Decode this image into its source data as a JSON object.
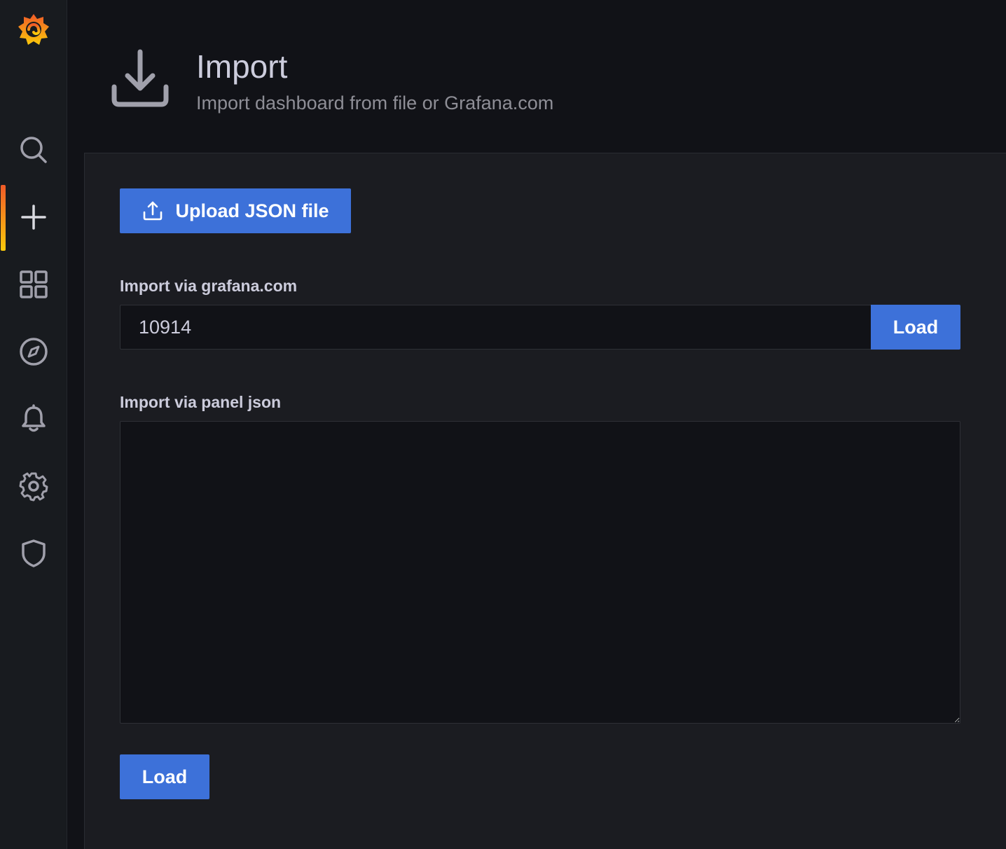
{
  "sidebar": {
    "logo": "grafana-logo-icon",
    "items": [
      {
        "icon": "search-icon"
      },
      {
        "icon": "plus-icon",
        "active": true
      },
      {
        "icon": "dashboards-grid-icon"
      },
      {
        "icon": "compass-icon"
      },
      {
        "icon": "bell-icon"
      },
      {
        "icon": "gear-icon"
      },
      {
        "icon": "shield-icon"
      }
    ]
  },
  "header": {
    "icon": "download-icon",
    "title": "Import",
    "subtitle": "Import dashboard from file or Grafana.com"
  },
  "upload": {
    "icon": "upload-icon",
    "label": "Upload JSON file"
  },
  "grafana_com": {
    "label": "Import via grafana.com",
    "value": "10914",
    "load_label": "Load"
  },
  "panel_json": {
    "label": "Import via panel json",
    "value": "",
    "load_label": "Load"
  },
  "colors": {
    "primary_button": "#3d71d9",
    "active_indicator_start": "#f05a28",
    "active_indicator_end": "#fbca0a",
    "background": "#111217",
    "panel": "#1b1c21"
  }
}
